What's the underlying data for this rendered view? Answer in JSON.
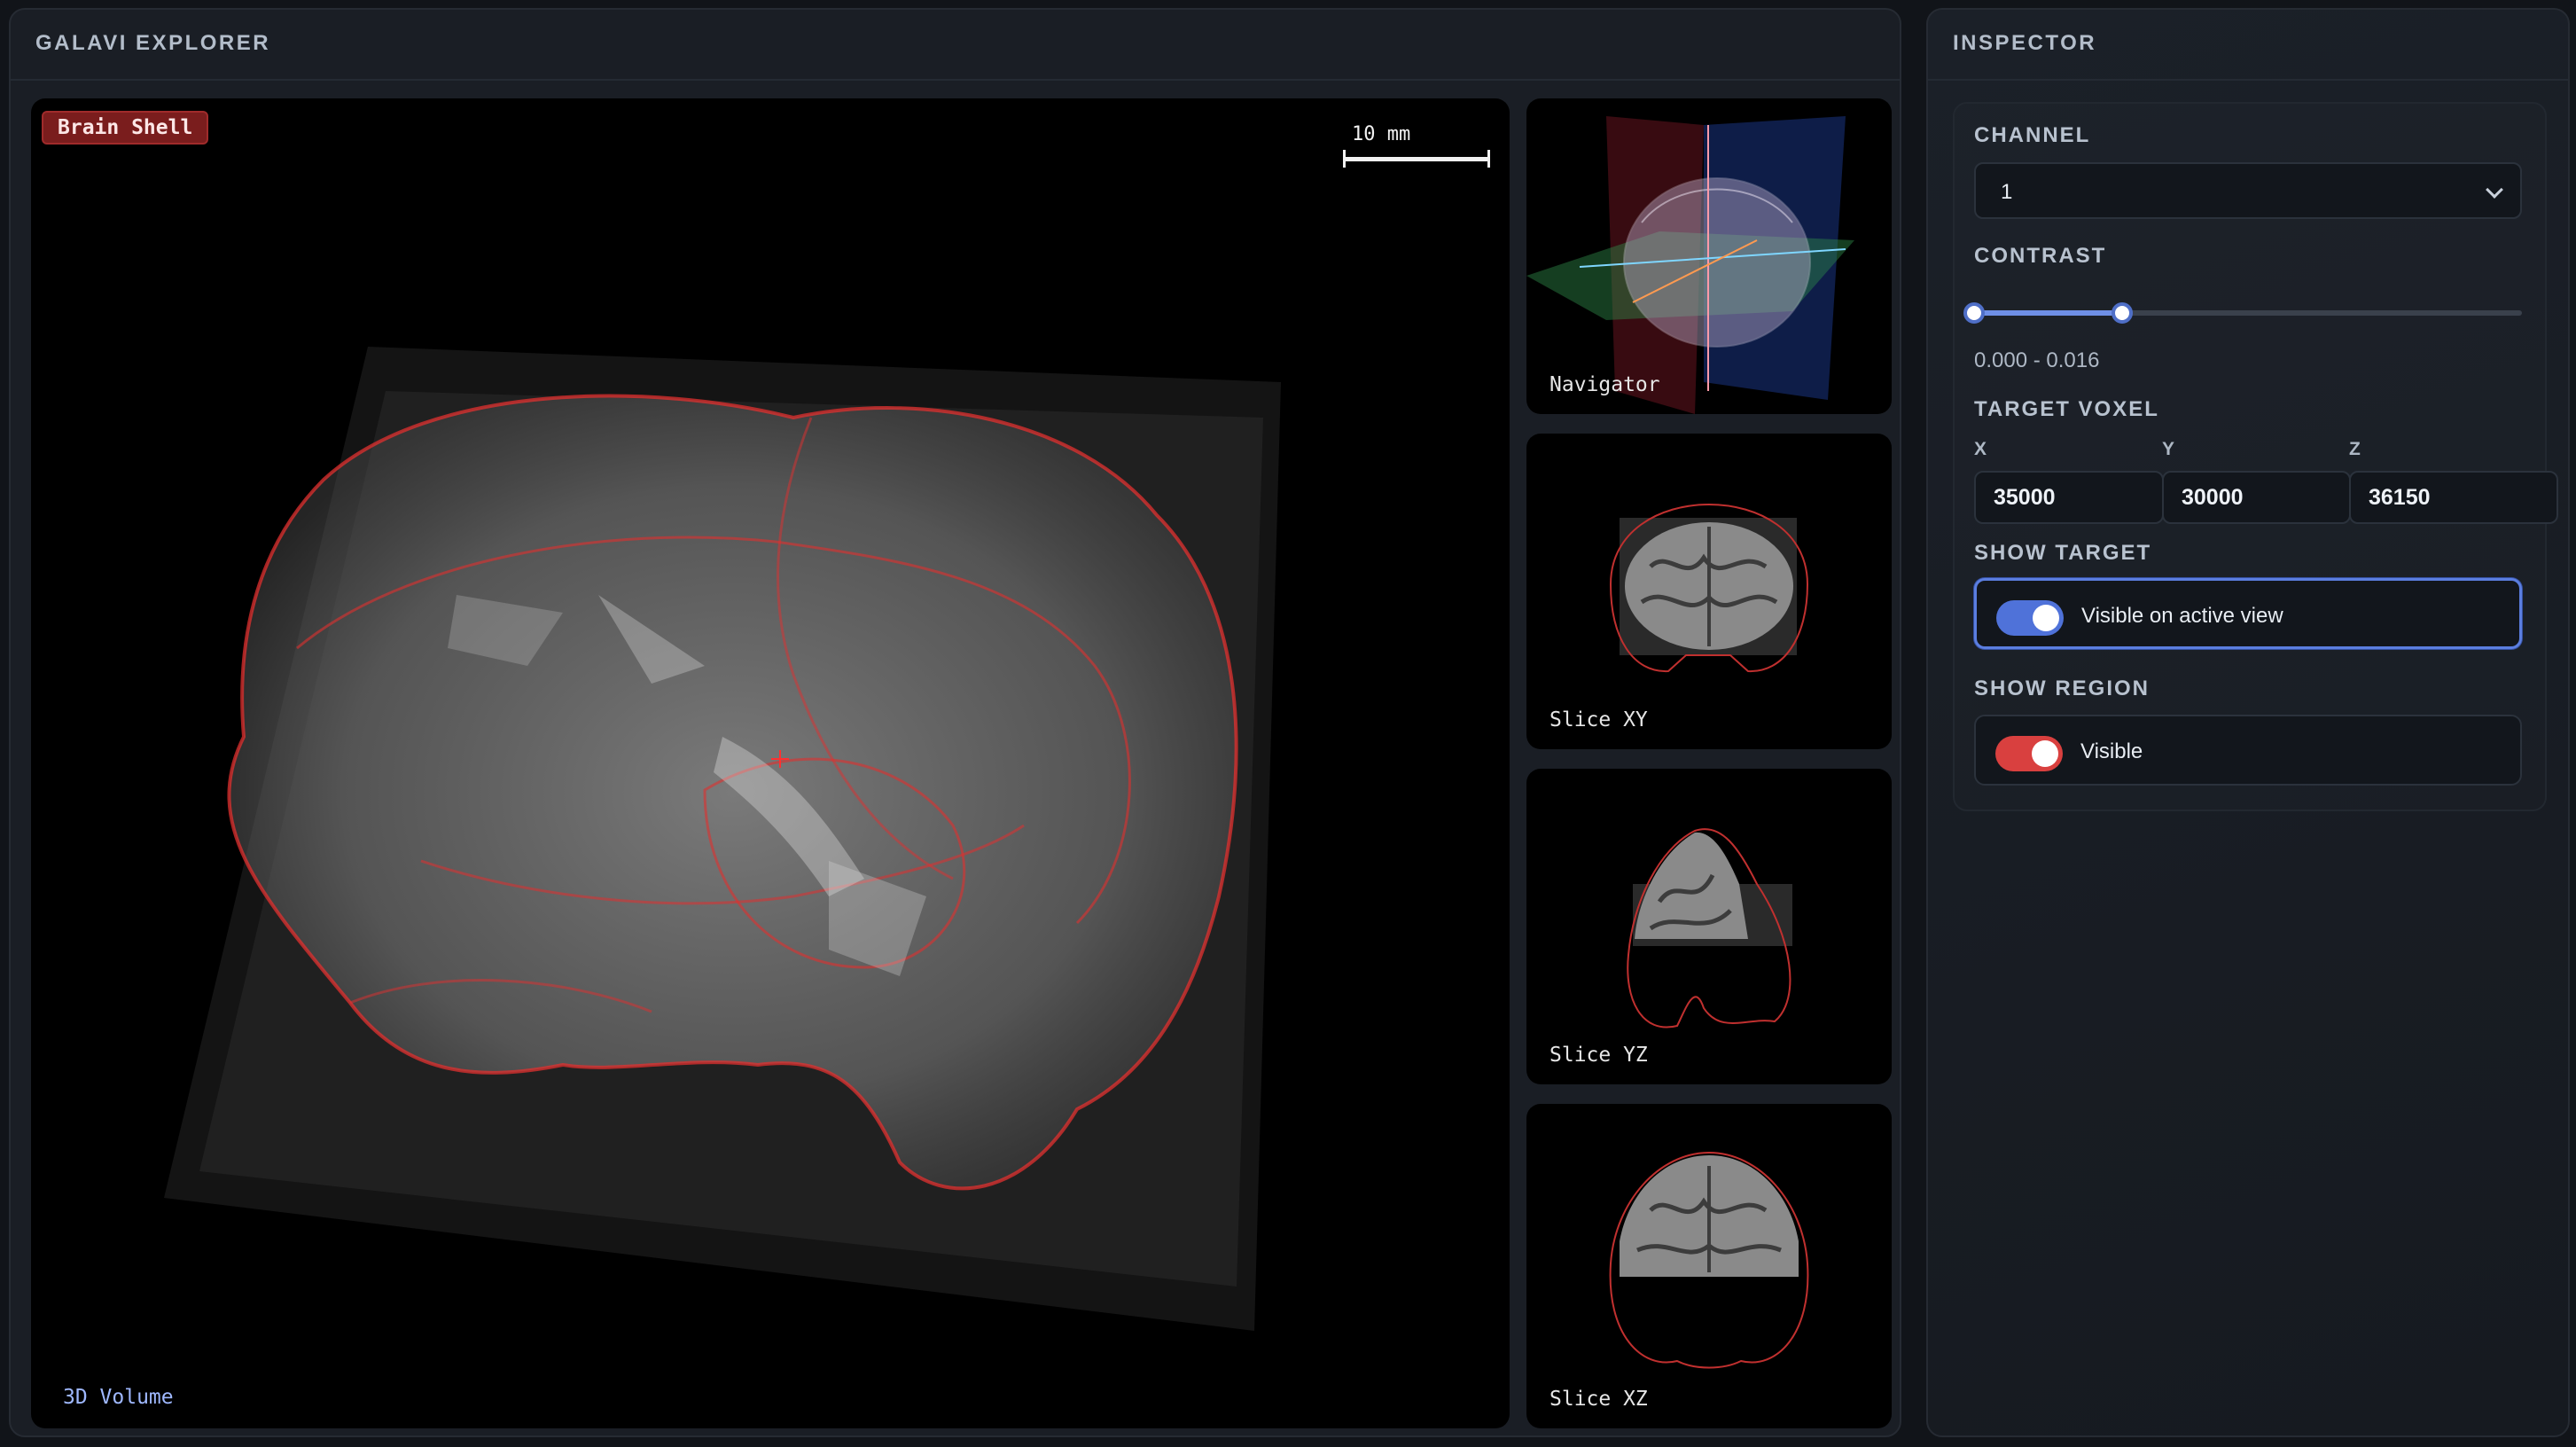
{
  "explorer": {
    "title": "GALAVI EXPLORER",
    "main_view": {
      "layer_tag": "Brain Shell",
      "scale_label": "10 mm",
      "label": "3D Volume"
    },
    "thumbnails": [
      {
        "label": "Navigator"
      },
      {
        "label": "Slice XY"
      },
      {
        "label": "Slice YZ"
      },
      {
        "label": "Slice XZ"
      }
    ]
  },
  "inspector": {
    "title": "INSPECTOR",
    "channel": {
      "label": "CHANNEL",
      "value": "1"
    },
    "contrast": {
      "label": "CONTRAST",
      "range_text": "0.000 - 0.016",
      "low_fraction": 0.0,
      "high_fraction": 0.27
    },
    "target_voxel": {
      "label": "TARGET VOXEL",
      "x_label": "X",
      "y_label": "Y",
      "z_label": "Z",
      "x": "35000",
      "y": "30000",
      "z": "36150"
    },
    "show_target": {
      "label": "SHOW TARGET",
      "text": "Visible on active view",
      "on": true,
      "color": "#4f72d9"
    },
    "show_region": {
      "label": "SHOW REGION",
      "text": "Visible",
      "on": true,
      "color": "#d9403f"
    }
  },
  "colors": {
    "accent_blue": "#4f72d9",
    "region_red": "#d9403f",
    "tag_red": "#7a1d1d"
  },
  "icons": {
    "select_chevron": "chevron-down-icon"
  }
}
